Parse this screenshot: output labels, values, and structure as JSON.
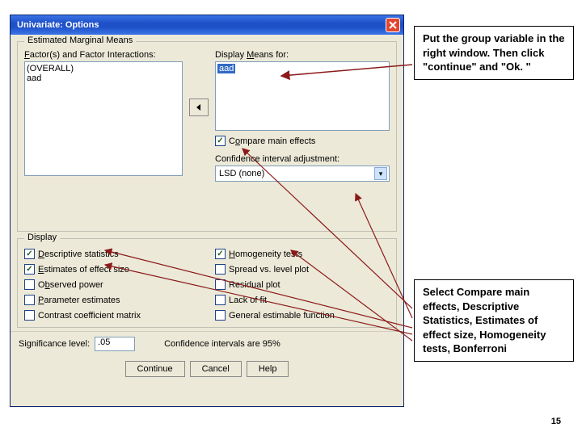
{
  "titlebar": {
    "title": "Univariate: Options"
  },
  "emm": {
    "legend": "Estimated Marginal Means",
    "factors_label_pre": "F",
    "factors_label_rest": "actor(s) and Factor Interactions:",
    "factors_items": [
      "(OVERALL)",
      "aad"
    ],
    "means_label_pre": "Display ",
    "means_label_key": "M",
    "means_label_rest": "eans for:",
    "means_items": [
      "aad"
    ],
    "compare_label_key": "o",
    "compare_label_pre": "C",
    "compare_label_rest": "mpare main effects",
    "ci_label": "Confidence interval adjustment:",
    "ci_value": "LSD (none)"
  },
  "display": {
    "legend": "Display",
    "L1": {
      "pre": "D",
      "rest": "escriptive statistics"
    },
    "L2": {
      "pre": "E",
      "rest": "stimates of effect size"
    },
    "L3": {
      "pre": "O",
      "rest": "bserved power",
      "keyalt": "b"
    },
    "L4": {
      "pre": "P",
      "rest": "arameter estimates"
    },
    "L5": {
      "rest": "Contrast coefficient matrix"
    },
    "R1": {
      "pre": "H",
      "rest": "omogeneity tests"
    },
    "R2": {
      "rest": "Spread vs. level plot"
    },
    "R3": {
      "rest": "Residual plot"
    },
    "R4": {
      "rest": "Lack of fit"
    },
    "R5": {
      "rest": "General estimable function"
    }
  },
  "bottom": {
    "sig_label": "Significance level:",
    "sig_value": ".05",
    "ci_text": "Confidence intervals are 95%"
  },
  "buttons": {
    "continue": "Continue",
    "cancel": "Cancel",
    "help": "Help"
  },
  "annot1": "Put the group variable in the right window. Then click \"continue\" and \"Ok. \"",
  "annot2": "Select Compare main effects, Descriptive Statistics, Estimates of effect size, Homogeneity tests, Bonferroni",
  "page_number": "15"
}
